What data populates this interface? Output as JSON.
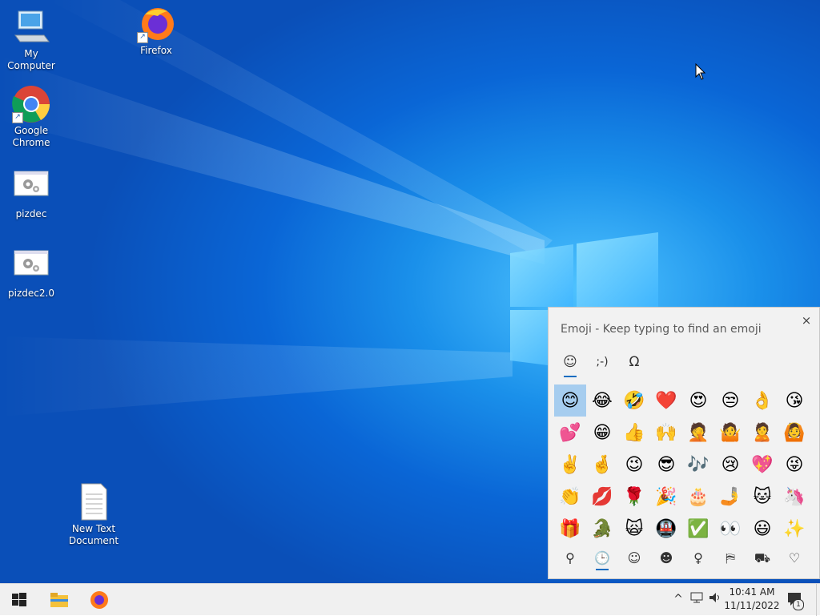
{
  "desktop": {
    "icons": [
      {
        "label": "My Computer"
      },
      {
        "label": "Firefox"
      },
      {
        "label": "Google Chrome"
      },
      {
        "label": "pizdec"
      },
      {
        "label": "pizdec2.0"
      },
      {
        "label": "New Text Document"
      }
    ]
  },
  "emoji_panel": {
    "title": "Emoji - Keep typing to find an emoji",
    "close_icon": "×",
    "tabs": [
      {
        "name": "emoji",
        "glyph": "☺"
      },
      {
        "name": "kaomoji",
        "glyph": ";-)"
      },
      {
        "name": "symbols",
        "glyph": "Ω"
      }
    ],
    "emojis": [
      "😊",
      "😂",
      "🤣",
      "❤️",
      "😍",
      "😒",
      "👌",
      "😘",
      "💕",
      "😁",
      "👍",
      "🙌",
      "🤦",
      "🤷",
      "🙎",
      "🙆",
      "✌️",
      "🤞",
      "😉",
      "😎",
      "🎶",
      "😢",
      "💖",
      "😜",
      "👏",
      "💋",
      "🌹",
      "🎉",
      "🎂",
      "🤳",
      "🐱",
      "🦄",
      "🎁",
      "🐊",
      "🙀",
      "🚇",
      "✅",
      "👀",
      "😃",
      "✨"
    ],
    "categories": [
      {
        "name": "search-icon",
        "glyph": "⚲"
      },
      {
        "name": "recent-icon",
        "glyph": "🕒"
      },
      {
        "name": "smiley-icon",
        "glyph": "☺"
      },
      {
        "name": "people-icon",
        "glyph": "☻"
      },
      {
        "name": "celebration-icon",
        "glyph": "♀"
      },
      {
        "name": "food-icon",
        "glyph": "⛿"
      },
      {
        "name": "transport-icon",
        "glyph": "⛟"
      },
      {
        "name": "heart-icon",
        "glyph": "♡"
      }
    ]
  },
  "taskbar": {
    "time": "10:41 AM",
    "date": "11/11/2022",
    "notification_count": "1"
  }
}
